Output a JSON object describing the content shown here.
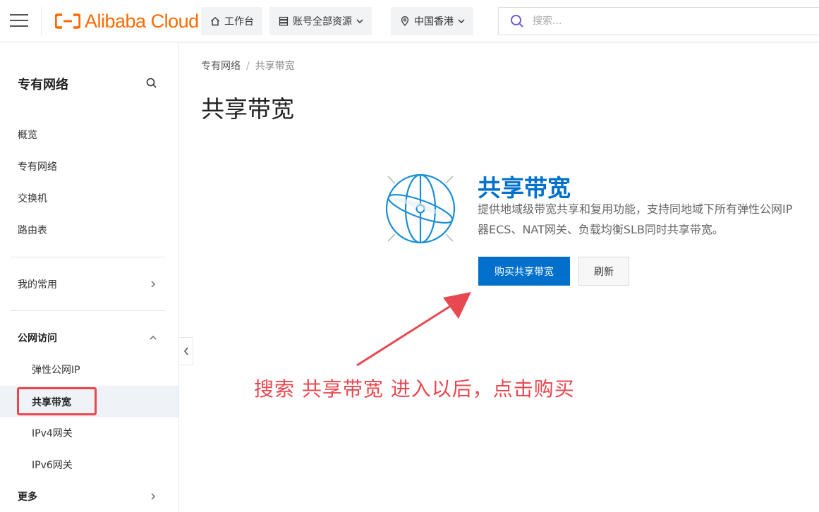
{
  "topbar": {
    "logo_text": "Alibaba Cloud",
    "workbench_label": "工作台",
    "resources_label": "账号全部资源",
    "region_label": "中国香港",
    "search_placeholder": "搜索..."
  },
  "sidebar": {
    "title": "专有网络",
    "items": [
      {
        "label": "概览"
      },
      {
        "label": "专有网络"
      },
      {
        "label": "交换机"
      },
      {
        "label": "路由表"
      }
    ],
    "favorites_label": "我的常用",
    "public_access_label": "公网访问",
    "public_access_items": [
      {
        "label": "弹性公网IP"
      },
      {
        "label": "共享带宽"
      },
      {
        "label": "IPv4网关"
      },
      {
        "label": "IPv6网关"
      }
    ],
    "more_label": "更多"
  },
  "breadcrumb": {
    "root": "专有网络",
    "separator": "/",
    "current": "共享带宽"
  },
  "page_title": "共享带宽",
  "promo": {
    "title": "共享带宽",
    "desc_line1": "提供地域级带宽共享和复用功能，支持同地域下所有弹性公网IP",
    "desc_line2": "器ECS、NAT网关、负载均衡SLB同时共享带宽。",
    "buy_label": "购买共享带宽",
    "refresh_label": "刷新"
  },
  "annotation": {
    "text": "搜索 共享带宽 进入以后，点击购买",
    "color": "#e8484f"
  },
  "colors": {
    "brand": "#ff6a00",
    "primary": "#0070cc",
    "annotation": "#e8484f"
  }
}
